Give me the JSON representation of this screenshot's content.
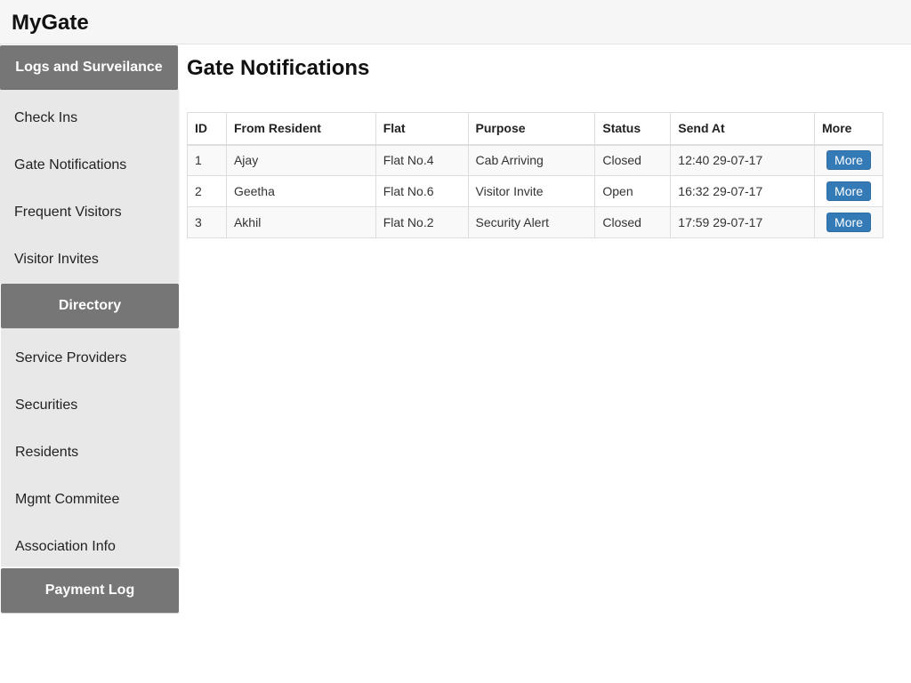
{
  "app": {
    "title": "MyGate"
  },
  "sidebar": {
    "sections": [
      {
        "header": "Logs and Surveilance",
        "items": [
          "Check Ins",
          "Gate Notifications",
          "Frequent Visitors",
          "Visitor Invites"
        ]
      },
      {
        "header": "Directory",
        "items": [
          "Service Providers",
          "Securities",
          "Residents",
          "Mgmt Commitee",
          "Association Info"
        ]
      },
      {
        "header": "Payment Log",
        "items": []
      }
    ]
  },
  "main": {
    "title": "Gate Notifications",
    "table": {
      "columns": [
        "ID",
        "From Resident",
        "Flat",
        "Purpose",
        "Status",
        "Send At",
        "More"
      ],
      "rows": [
        {
          "id": "1",
          "from_resident": "Ajay",
          "flat": "Flat No.4",
          "purpose": "Cab Arriving",
          "status": "Closed",
          "send_at": "12:40 29-07-17",
          "more": "More"
        },
        {
          "id": "2",
          "from_resident": "Geetha",
          "flat": "Flat No.6",
          "purpose": "Visitor Invite",
          "status": "Open",
          "send_at": "16:32 29-07-17",
          "more": "More"
        },
        {
          "id": "3",
          "from_resident": "Akhil",
          "flat": "Flat No.2",
          "purpose": "Security Alert",
          "status": "Closed",
          "send_at": "17:59 29-07-17",
          "more": "More"
        }
      ]
    }
  },
  "colors": {
    "section_header_bg": "#767676",
    "section_body_bg": "#e8e8e8",
    "button_primary": "#337ab7"
  }
}
